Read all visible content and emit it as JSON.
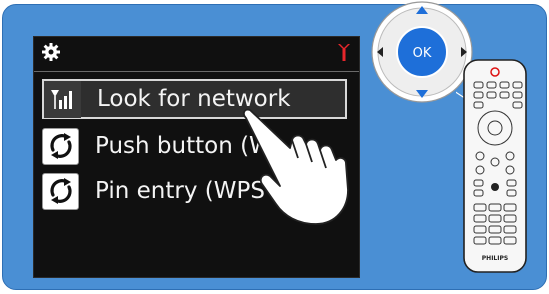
{
  "menu": {
    "items": [
      {
        "label": "Look for network",
        "icon": "signal-strength-icon",
        "selected": true
      },
      {
        "label": "Push button (W",
        "icon": "wps-icon",
        "selected": false
      },
      {
        "label": "Pin entry (WPS",
        "icon": "wps-icon",
        "selected": false
      }
    ]
  },
  "dpad": {
    "ok_label": "OK"
  },
  "remote": {
    "brand": "PHILIPS"
  },
  "colors": {
    "frame": "#4a8fd4",
    "screen": "#101010",
    "antenna": "#e8262b",
    "ok_button": "#1e6fd9",
    "dpad_arrows": "#1e6fd9"
  }
}
